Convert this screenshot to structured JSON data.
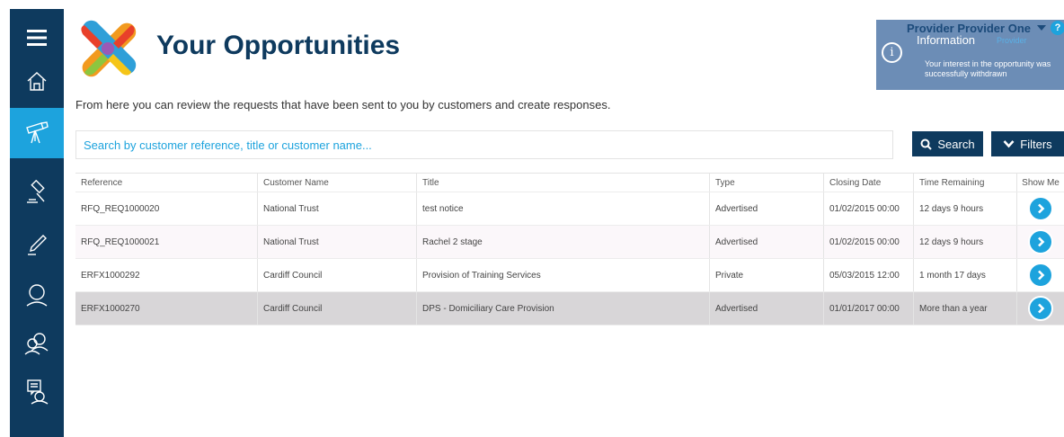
{
  "app": {
    "title": "Your Opportunities",
    "intro": "From here you can review the requests that have been sent to you by customers and create responses."
  },
  "sidebar": {
    "items": [
      {
        "icon": "menu-icon"
      },
      {
        "icon": "home-icon"
      },
      {
        "icon": "telescope-icon",
        "active": true
      },
      {
        "icon": "gavel-icon"
      },
      {
        "icon": "pen-icon"
      },
      {
        "icon": "user-icon"
      },
      {
        "icon": "users-icon"
      },
      {
        "icon": "support-chat-icon"
      }
    ]
  },
  "provider": {
    "name": "Provider Provider One",
    "role": "Provider",
    "help": "?"
  },
  "info": {
    "icon": "i",
    "heading": "Information",
    "message": "Your interest in the opportunity was successfully withdrawn"
  },
  "search": {
    "placeholder": "Search by customer reference, title or customer name...",
    "value": "",
    "button_label": "Search",
    "filters_label": "Filters"
  },
  "table": {
    "columns": [
      "Reference",
      "Customer Name",
      "Title",
      "Type",
      "Closing Date",
      "Time Remaining",
      "Show Me"
    ],
    "rows": [
      {
        "reference": "RFQ_REQ1000020",
        "customer": "National Trust",
        "title": "test notice",
        "type": "Advertised",
        "closing": "01/02/2015 00:00",
        "remaining": "12 days 9 hours"
      },
      {
        "reference": "RFQ_REQ1000021",
        "customer": "National Trust",
        "title": "Rachel 2 stage",
        "type": "Advertised",
        "closing": "01/02/2015 00:00",
        "remaining": "12 days 9 hours"
      },
      {
        "reference": "ERFX1000292",
        "customer": "Cardiff Council",
        "title": "Provision of Training Services",
        "type": "Private",
        "closing": "05/03/2015 12:00",
        "remaining": "1 month 17 days"
      },
      {
        "reference": "ERFX1000270",
        "customer": "Cardiff Council",
        "title": "DPS - Domiciliary Care Provision",
        "type": "Advertised",
        "closing": "01/01/2017 00:00",
        "remaining": "More than a year"
      }
    ]
  },
  "colors": {
    "sidebar": "#0e3a5e",
    "accent": "#1da3dd",
    "info_panel": "#6c8db6",
    "selected_row": "#d8d6d8"
  }
}
